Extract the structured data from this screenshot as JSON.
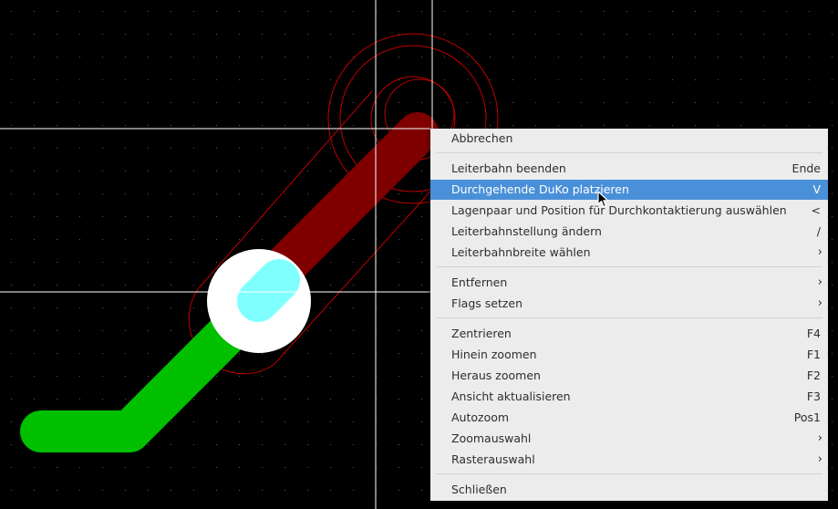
{
  "context_menu": {
    "items": [
      {
        "label": "Abbrechen",
        "shortcut": ""
      },
      {
        "label": "Leiterbahn beenden",
        "shortcut": "Ende"
      },
      {
        "label": "Durchgehende DuKo platzieren",
        "shortcut": "V",
        "highlighted": true
      },
      {
        "label": "Lagenpaar und Position für Durchkontaktierung auswählen",
        "shortcut": "<"
      },
      {
        "label": "Leiterbahnstellung ändern",
        "shortcut": "/"
      },
      {
        "label": "Leiterbahnbreite wählen",
        "shortcut": "",
        "submenu": true
      },
      {
        "label": "Entfernen",
        "shortcut": "",
        "submenu": true
      },
      {
        "label": "Flags setzen",
        "shortcut": "",
        "submenu": true
      },
      {
        "label": "Zentrieren",
        "shortcut": "F4"
      },
      {
        "label": "Hinein zoomen",
        "shortcut": "F1"
      },
      {
        "label": "Heraus zoomen",
        "shortcut": "F2"
      },
      {
        "label": "Ansicht aktualisieren",
        "shortcut": "F3"
      },
      {
        "label": "Autozoom",
        "shortcut": "Pos1"
      },
      {
        "label": "Zoomauswahl",
        "shortcut": "",
        "submenu": true
      },
      {
        "label": "Rasterauswahl",
        "shortcut": "",
        "submenu": true
      },
      {
        "label": "Schließen",
        "shortcut": ""
      }
    ],
    "submenu_arrow": "›",
    "highlight_color": "#4a90d9"
  },
  "canvas": {
    "background": "#000000",
    "track_front_color": "#00c000",
    "track_back_color": "#800000",
    "via_color": "#ffffff",
    "pad_color": "#80ffff",
    "clearance_color": "#c00000",
    "cursor_color": "#ffffff"
  }
}
